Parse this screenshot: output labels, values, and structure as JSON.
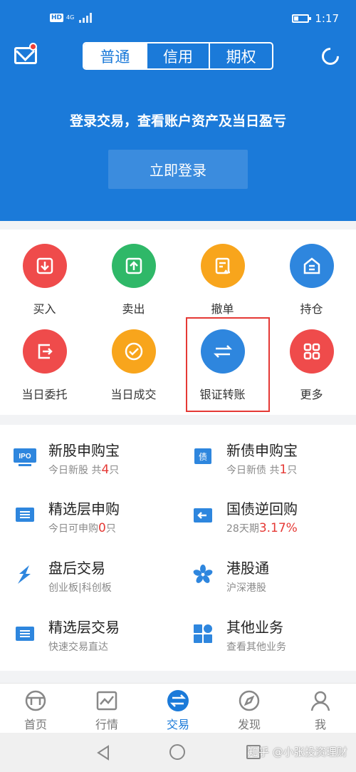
{
  "status_bar": {
    "network": "4G",
    "badge": "HD",
    "time": "1:17"
  },
  "header": {
    "tabs": [
      {
        "label": "普通",
        "active": true
      },
      {
        "label": "信用",
        "active": false
      },
      {
        "label": "期权",
        "active": false
      }
    ],
    "login_prompt": "登录交易，查看账户资产及当日盈亏",
    "login_button": "立即登录"
  },
  "functions": [
    {
      "label": "买入",
      "icon": "buy-icon",
      "color": "#ef4b4b"
    },
    {
      "label": "卖出",
      "icon": "sell-icon",
      "color": "#2fb868"
    },
    {
      "label": "撤单",
      "icon": "cancel-order-icon",
      "color": "#f8a51c"
    },
    {
      "label": "持仓",
      "icon": "position-icon",
      "color": "#2e86de"
    },
    {
      "label": "当日委托",
      "icon": "entrust-icon",
      "color": "#ef4b4b"
    },
    {
      "label": "当日成交",
      "icon": "deal-icon",
      "color": "#f8a51c"
    },
    {
      "label": "银证转账",
      "icon": "transfer-icon",
      "color": "#2e86de"
    },
    {
      "label": "更多",
      "icon": "more-grid-icon",
      "color": "#ef4b4b"
    }
  ],
  "services": [
    {
      "title": "新股申购宝",
      "sub_pre": "今日新股 共",
      "sub_num": "4",
      "sub_post": "只",
      "icon": "ipo-icon"
    },
    {
      "title": "新债申购宝",
      "sub_pre": "今日新债 共",
      "sub_num": "1",
      "sub_post": "只",
      "icon": "bond-icon"
    },
    {
      "title": "精选层申购",
      "sub_pre": "今日可申购",
      "sub_num": "0",
      "sub_post": "只",
      "icon": "select-subscribe-icon"
    },
    {
      "title": "国债逆回购",
      "sub_pre": "28天期",
      "sub_num": "3.17%",
      "sub_post": "",
      "icon": "repo-icon"
    },
    {
      "title": "盘后交易",
      "sub_pre": "创业板|科创板",
      "sub_num": "",
      "sub_post": "",
      "icon": "after-hours-icon"
    },
    {
      "title": "港股通",
      "sub_pre": "沪深港股",
      "sub_num": "",
      "sub_post": "",
      "icon": "hk-connect-icon"
    },
    {
      "title": "精选层交易",
      "sub_pre": "快速交易直达",
      "sub_num": "",
      "sub_post": "",
      "icon": "select-trade-icon"
    },
    {
      "title": "其他业务",
      "sub_pre": "查看其他业务",
      "sub_num": "",
      "sub_post": "",
      "icon": "other-business-icon"
    }
  ],
  "bottom_nav": [
    {
      "label": "首页",
      "active": false
    },
    {
      "label": "行情",
      "active": false
    },
    {
      "label": "交易",
      "active": true
    },
    {
      "label": "发现",
      "active": false
    },
    {
      "label": "我",
      "active": false
    }
  ],
  "watermark": "知乎 @小张投资理财",
  "colors": {
    "primary": "#1b7ad9",
    "highlight": "#e53935",
    "red_value": "#e53935"
  }
}
